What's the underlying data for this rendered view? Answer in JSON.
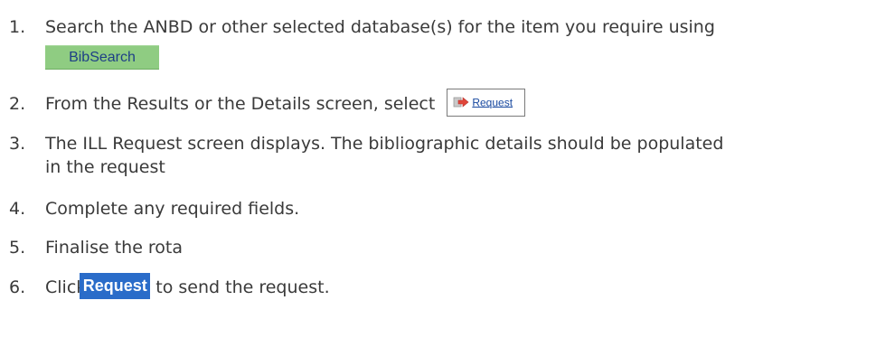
{
  "steps": [
    {
      "number": "1.",
      "text": "Search the ANBD or other selected database(s) for the item you require using",
      "button_label": "BibSearch"
    },
    {
      "number": "2.",
      "text": "From the Results or the Details screen, select",
      "button_label": "Request",
      "button_icon": "request-arrow-icon"
    },
    {
      "number": "3.",
      "text_line1": "The ILL Request screen displays. The bibliographic details should be populated",
      "text_line2": "in the request"
    },
    {
      "number": "4.",
      "text": "Complete any required fields."
    },
    {
      "number": "5.",
      "text": "Finalise the rota"
    },
    {
      "number": "6.",
      "text_before": "Click",
      "button_label": "Request",
      "text_after": "to send the request."
    }
  ],
  "colors": {
    "body_text": "#3a3a3a",
    "bibsearch_bg": "#8fcc82",
    "bibsearch_text": "#1e3f86",
    "request_link_text": "#1a4aa0",
    "request_button_bg": "#2a6cc9",
    "request_button_text": "#ffffff",
    "request_icon": "#e0463a"
  }
}
